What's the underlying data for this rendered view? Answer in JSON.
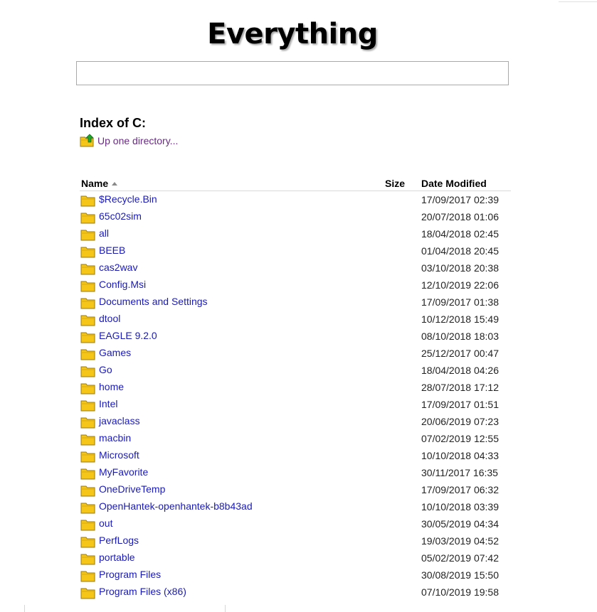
{
  "logo": {
    "text": "Everything"
  },
  "search": {
    "value": "",
    "placeholder": ""
  },
  "index": {
    "title": "Index of C:",
    "up_link": "Up one directory..."
  },
  "table": {
    "headers": {
      "name": "Name",
      "size": "Size",
      "date": "Date Modified"
    },
    "sort": {
      "column": "name",
      "direction": "ascending"
    },
    "rows": [
      {
        "name": "$Recycle.Bin",
        "date": "17/09/2017 02:39"
      },
      {
        "name": "65c02sim",
        "date": "20/07/2018 01:06"
      },
      {
        "name": "all",
        "date": "18/04/2018 02:45"
      },
      {
        "name": "BEEB",
        "date": "01/04/2018 20:45"
      },
      {
        "name": "cas2wav",
        "date": "03/10/2018 20:38"
      },
      {
        "name": "Config.Msi",
        "date": "12/10/2019 22:06"
      },
      {
        "name": "Documents and Settings",
        "date": "17/09/2017 01:38"
      },
      {
        "name": "dtool",
        "date": "10/12/2018 15:49"
      },
      {
        "name": "EAGLE 9.2.0",
        "date": "08/10/2018 18:03"
      },
      {
        "name": "Games",
        "date": "25/12/2017 00:47"
      },
      {
        "name": "Go",
        "date": "18/04/2018 04:26"
      },
      {
        "name": "home",
        "date": "28/07/2018 17:12"
      },
      {
        "name": "Intel",
        "date": "17/09/2017 01:51"
      },
      {
        "name": "javaclass",
        "date": "20/06/2019 07:23"
      },
      {
        "name": "macbin",
        "date": "07/02/2019 12:55"
      },
      {
        "name": "Microsoft",
        "date": "10/10/2018 04:33"
      },
      {
        "name": "MyFavorite",
        "date": "30/11/2017 16:35"
      },
      {
        "name": "OneDriveTemp",
        "date": "17/09/2017 06:32"
      },
      {
        "name": "OpenHantek-openhantek-b8b43ad",
        "date": "10/10/2018 03:39"
      },
      {
        "name": "out",
        "date": "30/05/2019 04:34"
      },
      {
        "name": "PerfLogs",
        "date": "19/03/2019 04:52"
      },
      {
        "name": "portable",
        "date": "05/02/2019 07:42"
      },
      {
        "name": "Program Files",
        "date": "30/08/2019 15:50"
      },
      {
        "name": "Program Files (x86)",
        "date": "07/10/2019 19:58"
      }
    ]
  },
  "icons": {
    "folder": "folder-icon",
    "up": "folder-up-icon",
    "sort": "sort-ascending-icon"
  },
  "colors": {
    "link": "#1a1ab5",
    "visited_link": "#6a2b84",
    "folder_fill": "#f5c518",
    "folder_stroke": "#9a7a10",
    "up_arrow": "#1fa82a"
  }
}
